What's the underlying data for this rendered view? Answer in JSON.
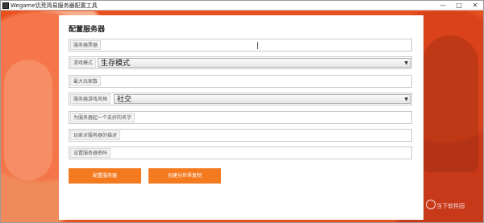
{
  "window": {
    "title": "Wegame饥荒简易服务器配置工具",
    "controls": {
      "minimize": "—",
      "maximize": "□",
      "close": "✕"
    }
  },
  "panel": {
    "title": "配置服务器"
  },
  "form": {
    "server_name": {
      "label": "服务器票据",
      "value": ""
    },
    "game_mode": {
      "label": "游戏模式",
      "selected": "生存模式"
    },
    "max_players": {
      "label": "最大玩家数",
      "value": ""
    },
    "play_style": {
      "label": "服务器游戏风格",
      "selected": "社交"
    },
    "friendly_name": {
      "label": "为服务器起一个友好的名字",
      "value": ""
    },
    "description": {
      "label": "玩家对服务器的描述",
      "value": ""
    },
    "password": {
      "label": "设置服务器密码",
      "value": ""
    }
  },
  "buttons": {
    "configure": "配置服务器",
    "generate": "创建分世界复制"
  },
  "watermark": {
    "text": "当下软件园"
  },
  "colors": {
    "accent": "#f47a20",
    "background": "#e8501e",
    "panel": "#ffffff"
  }
}
